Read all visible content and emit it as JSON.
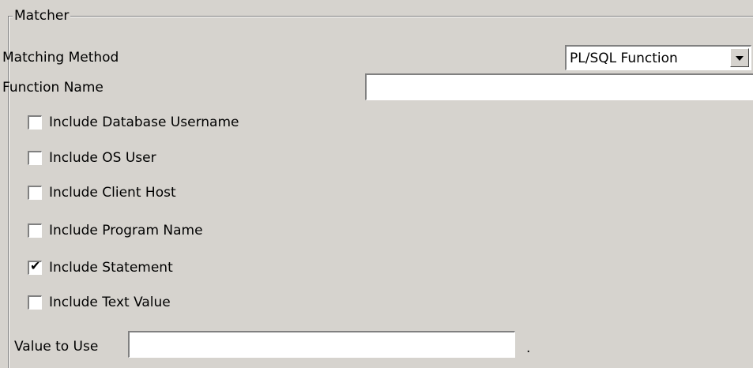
{
  "matcher": {
    "legend": "Matcher",
    "matching_method_label": "Matching Method",
    "matching_method_value": "PL/SQL Function",
    "function_name_label": "Function Name",
    "function_name_value": "",
    "checkboxes": [
      {
        "label": "Include Database Username",
        "checked": false
      },
      {
        "label": "Include OS User",
        "checked": false
      },
      {
        "label": "Include Client Host",
        "checked": false
      },
      {
        "label": "Include Program Name",
        "checked": false
      },
      {
        "label": "Include Statement",
        "checked": true
      },
      {
        "label": "Include Text Value",
        "checked": false
      }
    ],
    "value_to_use_label": "Value to Use",
    "value_to_use_value": "",
    "trailing_dot": "."
  },
  "icons": {
    "combo_arrow": "chevron-down-icon",
    "checkmark": "checkmark-icon"
  }
}
